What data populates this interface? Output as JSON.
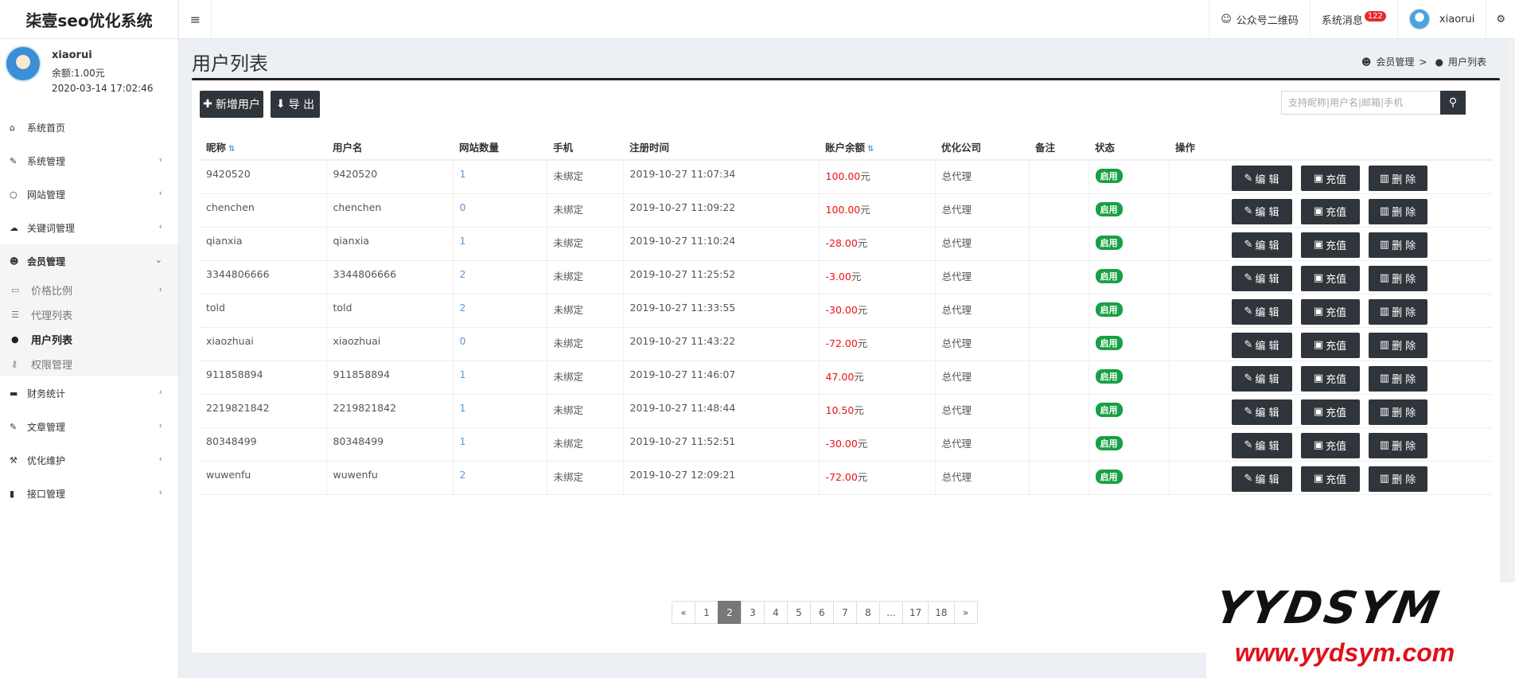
{
  "app": {
    "title": "柒壹seo优化系统"
  },
  "topbar": {
    "menu_icon": "≡",
    "wechat_label": "公众号二维码",
    "messages_label": "系统消息",
    "messages_count": "122",
    "user_name": "xiaorui"
  },
  "user": {
    "name": "xiaorui",
    "balance": "余额:1.00元",
    "time": "2020-03-14 17:02:46"
  },
  "sidebar": {
    "items": [
      {
        "label": "系统首页",
        "icon": "home-icon"
      },
      {
        "label": "系统管理",
        "icon": "wrench-icon"
      },
      {
        "label": "网站管理",
        "icon": "circle-icon"
      },
      {
        "label": "关键词管理",
        "icon": "cloud-icon"
      },
      {
        "label": "会员管理",
        "icon": "users-icon"
      },
      {
        "label": "财务统计",
        "icon": "card-icon"
      },
      {
        "label": "文章管理",
        "icon": "edit-icon"
      },
      {
        "label": "优化维护",
        "icon": "gavel-icon"
      },
      {
        "label": "接口管理",
        "icon": "book-icon"
      }
    ],
    "sub_items": [
      {
        "label": "价格比例"
      },
      {
        "label": "代理列表"
      },
      {
        "label": "用户列表"
      },
      {
        "label": "权限管理"
      }
    ]
  },
  "page": {
    "title": "用户列表",
    "breadcrumb_parent": "会员管理",
    "breadcrumb_sep": ">",
    "breadcrumb_current": "用户列表"
  },
  "toolbar": {
    "add_label": "新增用户",
    "export_label": "导 出",
    "search_placeholder": "支持昵称|用户名|邮箱|手机"
  },
  "table": {
    "headers": [
      "昵称",
      "用户名",
      "网站数量",
      "手机",
      "注册时间",
      "账户余额",
      "优化公司",
      "备注",
      "状态",
      "操作"
    ],
    "rows": [
      {
        "nick": "9420520",
        "username": "9420520",
        "sites": "1",
        "phone": "未绑定",
        "time": "2019-10-27 11:07:34",
        "balance": "100.00",
        "company": "总代理",
        "note": "",
        "status": "启用"
      },
      {
        "nick": "chenchen",
        "username": "chenchen",
        "sites": "0",
        "phone": "未绑定",
        "time": "2019-10-27 11:09:22",
        "balance": "100.00",
        "company": "总代理",
        "note": "",
        "status": "启用"
      },
      {
        "nick": "qianxia",
        "username": "qianxia",
        "sites": "1",
        "phone": "未绑定",
        "time": "2019-10-27 11:10:24",
        "balance": "-28.00",
        "company": "总代理",
        "note": "",
        "status": "启用"
      },
      {
        "nick": "3344806666",
        "username": "3344806666",
        "sites": "2",
        "phone": "未绑定",
        "time": "2019-10-27 11:25:52",
        "balance": "-3.00",
        "company": "总代理",
        "note": "",
        "status": "启用"
      },
      {
        "nick": "told",
        "username": "told",
        "sites": "2",
        "phone": "未绑定",
        "time": "2019-10-27 11:33:55",
        "balance": "-30.00",
        "company": "总代理",
        "note": "",
        "status": "启用"
      },
      {
        "nick": "xiaozhuai",
        "username": "xiaozhuai",
        "sites": "0",
        "phone": "未绑定",
        "time": "2019-10-27 11:43:22",
        "balance": "-72.00",
        "company": "总代理",
        "note": "",
        "status": "启用"
      },
      {
        "nick": "911858894",
        "username": "911858894",
        "sites": "1",
        "phone": "未绑定",
        "time": "2019-10-27 11:46:07",
        "balance": "47.00",
        "company": "总代理",
        "note": "",
        "status": "启用"
      },
      {
        "nick": "2219821842",
        "username": "2219821842",
        "sites": "1",
        "phone": "未绑定",
        "time": "2019-10-27 11:48:44",
        "balance": "10.50",
        "company": "总代理",
        "note": "",
        "status": "启用"
      },
      {
        "nick": "80348499",
        "username": "80348499",
        "sites": "1",
        "phone": "未绑定",
        "time": "2019-10-27 11:52:51",
        "balance": "-30.00",
        "company": "总代理",
        "note": "",
        "status": "启用"
      },
      {
        "nick": "wuwenfu",
        "username": "wuwenfu",
        "sites": "2",
        "phone": "未绑定",
        "time": "2019-10-27 12:09:21",
        "balance": "-72.00",
        "company": "总代理",
        "note": "",
        "status": "启用"
      }
    ],
    "currency_suffix": "元",
    "actions": {
      "edit": "编 辑",
      "charge": "充值",
      "delete": "删 除"
    }
  },
  "pagination": {
    "pages": [
      "«",
      "1",
      "2",
      "3",
      "4",
      "5",
      "6",
      "7",
      "8",
      "...",
      "17",
      "18",
      "»"
    ],
    "current": "2"
  },
  "watermark": {
    "logo": "YYDSYM",
    "url": "www.yydsym.com"
  },
  "colors": {
    "accent_dark": "#2f353b",
    "status_green": "#18a045",
    "negative_red": "#e11111",
    "link_blue": "#5b9bd5"
  }
}
